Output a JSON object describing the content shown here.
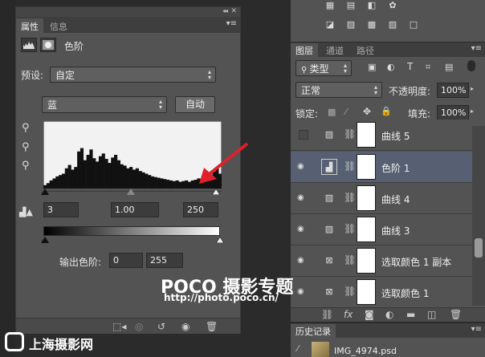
{
  "properties": {
    "tabs": [
      "属性",
      "信息"
    ],
    "title": "色阶",
    "preset_label": "预设:",
    "preset_value": "自定",
    "channel_value": "蓝",
    "auto_label": "自动",
    "input_black": "3",
    "input_gamma": "1.00",
    "input_white": "250",
    "output_label": "输出色阶:",
    "output_black": "0",
    "output_white": "255"
  },
  "layers": {
    "tabs": [
      "图层",
      "通道",
      "路径"
    ],
    "filter_label": "类型",
    "blend_mode": "正常",
    "opacity_label": "不透明度:",
    "opacity_value": "100%",
    "lock_label": "锁定:",
    "fill_label": "填充:",
    "fill_value": "100%",
    "items": [
      {
        "name": "曲线 5",
        "visible": false,
        "type": "curves",
        "selected": false
      },
      {
        "name": "色阶 1",
        "visible": true,
        "type": "levels",
        "selected": true
      },
      {
        "name": "曲线 4",
        "visible": true,
        "type": "curves",
        "selected": false
      },
      {
        "name": "曲线 3",
        "visible": true,
        "type": "curves",
        "selected": false
      },
      {
        "name": "选取颜色 1 副本",
        "visible": true,
        "type": "selective-color",
        "selected": false
      },
      {
        "name": "选取颜色 1",
        "visible": true,
        "type": "selective-color",
        "selected": false
      }
    ]
  },
  "history": {
    "title": "历史记录",
    "item": "IMG_4974.psd"
  },
  "watermark": {
    "brand": "POCO 摄影专题",
    "url": "http://photo.poco.cn/",
    "corner": "上海摄影网"
  },
  "colors": {
    "panel": "#535353",
    "selected_row": "#576072",
    "arrow": "#e0202a"
  },
  "histogram": {
    "channel": "blue",
    "levels": [
      0.05,
      0.08,
      0.12,
      0.15,
      0.18,
      0.2,
      0.22,
      0.3,
      0.35,
      0.28,
      0.32,
      0.55,
      0.6,
      0.42,
      0.5,
      0.58,
      0.45,
      0.4,
      0.48,
      0.52,
      0.44,
      0.38,
      0.46,
      0.5,
      0.42,
      0.36,
      0.34,
      0.3,
      0.32,
      0.28,
      0.3,
      0.26,
      0.24,
      0.22,
      0.2,
      0.18,
      0.17,
      0.16,
      0.15,
      0.14,
      0.13,
      0.12,
      0.11,
      0.12,
      0.1,
      0.11,
      0.12,
      0.1,
      0.12,
      0.13,
      0.15,
      0.14,
      0.16,
      0.2,
      0.18,
      0.25,
      0.3,
      0.22
    ]
  }
}
